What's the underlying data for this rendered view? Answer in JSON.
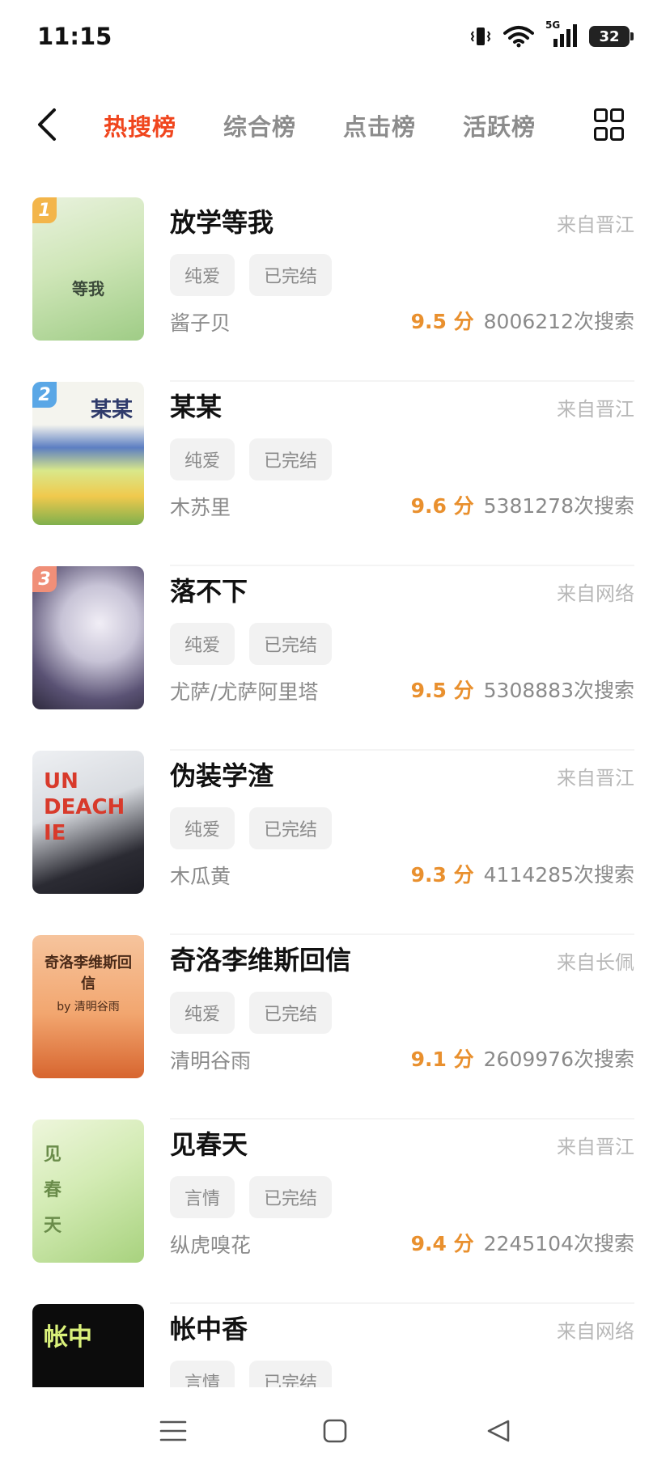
{
  "status_bar": {
    "time": "11:15",
    "network": "5G",
    "battery": "32"
  },
  "header": {
    "tabs": [
      "热搜榜",
      "综合榜",
      "点击榜",
      "活跃榜"
    ],
    "active_tab": "热搜榜"
  },
  "colors": {
    "accent": "#f0461e",
    "score": "#e9902e"
  },
  "books": [
    {
      "rank": "1",
      "title": "放学等我",
      "source": "来自晋江",
      "tags": [
        "纯爱",
        "已完结"
      ],
      "author": "酱子贝",
      "score": "9.5 分",
      "searches": "8006212次搜索",
      "cover_title": "等我",
      "cover_color": "#cfe6b8",
      "rank_color": "#f3b54a"
    },
    {
      "rank": "2",
      "title": "某某",
      "source": "来自晋江",
      "tags": [
        "纯爱",
        "已完结"
      ],
      "author": "木苏里",
      "score": "9.6 分",
      "searches": "5381278次搜索",
      "cover_title": "某某",
      "cover_color": "#d9e88a",
      "rank_color": "#5aa7e6"
    },
    {
      "rank": "3",
      "title": "落不下",
      "source": "来自网络",
      "tags": [
        "纯爱",
        "已完结"
      ],
      "author": "尤萨/尤萨阿里塔",
      "score": "9.5 分",
      "searches": "5308883次搜索",
      "cover_title": "",
      "cover_color": "#c7c3d6",
      "rank_color": "#f08f78"
    },
    {
      "rank": "",
      "title": "伪装学渣",
      "source": "来自晋江",
      "tags": [
        "纯爱",
        "已完结"
      ],
      "author": "木瓜黄",
      "score": "9.3 分",
      "searches": "4114285次搜索",
      "cover_title": "UN DEACH IE",
      "cover_color": "#e2e3e6",
      "rank_color": ""
    },
    {
      "rank": "",
      "title": "奇洛李维斯回信",
      "source": "来自长佩",
      "tags": [
        "纯爱",
        "已完结"
      ],
      "author": "清明谷雨",
      "score": "9.1 分",
      "searches": "2609976次搜索",
      "cover_title": "奇洛李维斯回信",
      "cover_sub": "by 清明谷雨",
      "cover_color": "#f2a66f",
      "rank_color": ""
    },
    {
      "rank": "",
      "title": "见春天",
      "source": "来自晋江",
      "tags": [
        "言情",
        "已完结"
      ],
      "author": "纵虎嗅花",
      "score": "9.4 分",
      "searches": "2245104次搜索",
      "cover_title": "见春天",
      "cover_color": "#d3ebb4",
      "rank_color": ""
    },
    {
      "rank": "",
      "title": "帐中香",
      "source": "来自网络",
      "tags": [
        "言情",
        "已完结"
      ],
      "author": "",
      "score": "",
      "searches": "",
      "cover_title": "帐中",
      "cover_color": "#0c0c0c",
      "rank_color": ""
    }
  ],
  "nav": {
    "menu": "menu-icon",
    "home": "home-icon",
    "back": "back-icon"
  }
}
